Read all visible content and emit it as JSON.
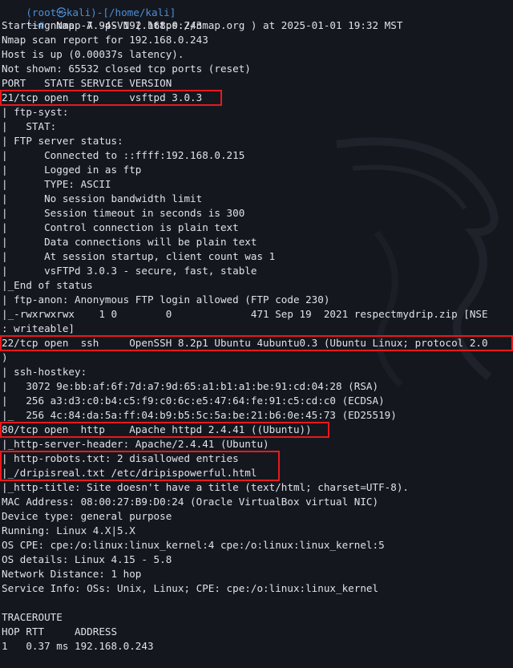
{
  "terminal": {
    "top_partial": "(root㉿kali)-[/home/kali]",
    "prompt_symbol": "└─#",
    "command": "nmap -A -p- 192.168.0.243",
    "lines": [
      "Starting Nmap 7.94SVN ( https://nmap.org ) at 2025-01-01 19:32 MST",
      "Nmap scan report for 192.168.0.243",
      "Host is up (0.00037s latency).",
      "Not shown: 65532 closed tcp ports (reset)",
      "PORT   STATE SERVICE VERSION",
      "21/tcp open  ftp     vsftpd 3.0.3",
      "| ftp-syst:",
      "|   STAT:",
      "| FTP server status:",
      "|      Connected to ::ffff:192.168.0.215",
      "|      Logged in as ftp",
      "|      TYPE: ASCII",
      "|      No session bandwidth limit",
      "|      Session timeout in seconds is 300",
      "|      Control connection is plain text",
      "|      Data connections will be plain text",
      "|      At session startup, client count was 1",
      "|      vsFTPd 3.0.3 - secure, fast, stable",
      "|_End of status",
      "| ftp-anon: Anonymous FTP login allowed (FTP code 230)",
      "|_-rwxrwxrwx    1 0        0             471 Sep 19  2021 respectmydrip.zip [NSE",
      ": writeable]",
      "22/tcp open  ssh     OpenSSH 8.2p1 Ubuntu 4ubuntu0.3 (Ubuntu Linux; protocol 2.0",
      ")",
      "| ssh-hostkey:",
      "|   3072 9e:bb:af:6f:7d:a7:9d:65:a1:b1:a1:be:91:cd:04:28 (RSA)",
      "|   256 a3:d3:c0:b4:c5:f9:c0:6c:e5:47:64:fe:91:c5:cd:c0 (ECDSA)",
      "|_  256 4c:84:da:5a:ff:04:b9:b5:5c:5a:be:21:b6:0e:45:73 (ED25519)",
      "80/tcp open  http    Apache httpd 2.4.41 ((Ubuntu))",
      "|_http-server-header: Apache/2.4.41 (Ubuntu)",
      "| http-robots.txt: 2 disallowed entries",
      "|_/dripisreal.txt /etc/dripispowerful.html",
      "|_http-title: Site doesn't have a title (text/html; charset=UTF-8).",
      "MAC Address: 08:00:27:B9:D0:24 (Oracle VirtualBox virtual NIC)",
      "Device type: general purpose",
      "Running: Linux 4.X|5.X",
      "OS CPE: cpe:/o:linux:linux_kernel:4 cpe:/o:linux:linux_kernel:5",
      "OS details: Linux 4.15 - 5.8",
      "Network Distance: 1 hop",
      "Service Info: OSs: Unix, Linux; CPE: cpe:/o:linux:linux_kernel",
      "",
      "TRACEROUTE",
      "HOP RTT     ADDRESS",
      "1   0.37 ms 192.168.0.243"
    ]
  }
}
